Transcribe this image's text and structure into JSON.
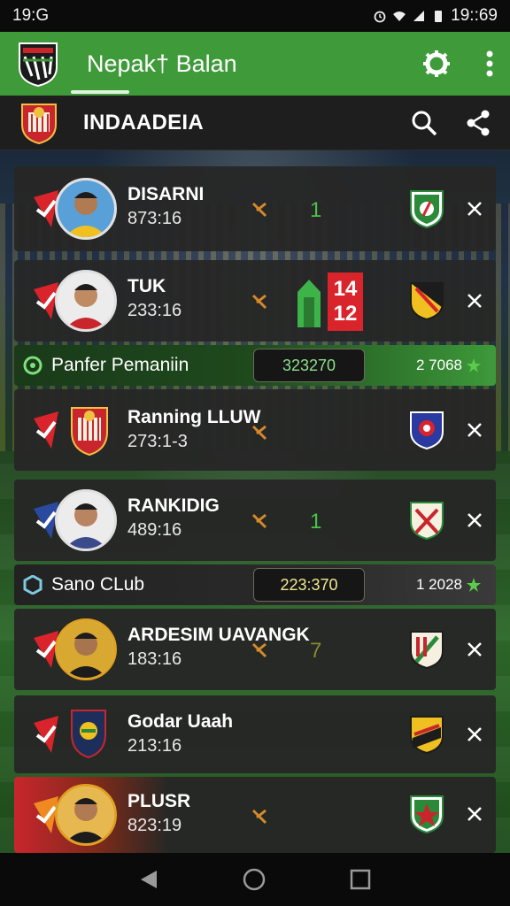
{
  "status_bar": {
    "time_left": "19:G",
    "time_right": "19::69"
  },
  "app_bar": {
    "title": "Nepak† Balan"
  },
  "sub_header": {
    "title": "INDAADEIA"
  },
  "players": [
    {
      "name": "DISARNI",
      "time": "873:16",
      "score": "1"
    },
    {
      "name": "TUK",
      "time": "233:16",
      "score_top": "14",
      "score_bottom": "12"
    },
    {
      "name": "Ranning LLUW",
      "time": "273:1-3"
    },
    {
      "name": "RANKIDIG",
      "time": "489:16",
      "score": "1"
    },
    {
      "name": "ARDESIM UAVANGK",
      "time": "183:16",
      "score": "7"
    },
    {
      "name": "Godar Uaah",
      "time": "213:16"
    },
    {
      "name": "PLUSR",
      "time": "823:19"
    }
  ],
  "clubs": [
    {
      "label": "Panfer Pemaniin",
      "value": "323270",
      "rating": "2 7068"
    },
    {
      "label": "Sano CLub",
      "value": "223:370",
      "rating": "1 2028"
    }
  ],
  "colors": {
    "accent_green": "#3f9a3a",
    "score_red": "#d8242a",
    "x_orange": "#d4892a"
  }
}
